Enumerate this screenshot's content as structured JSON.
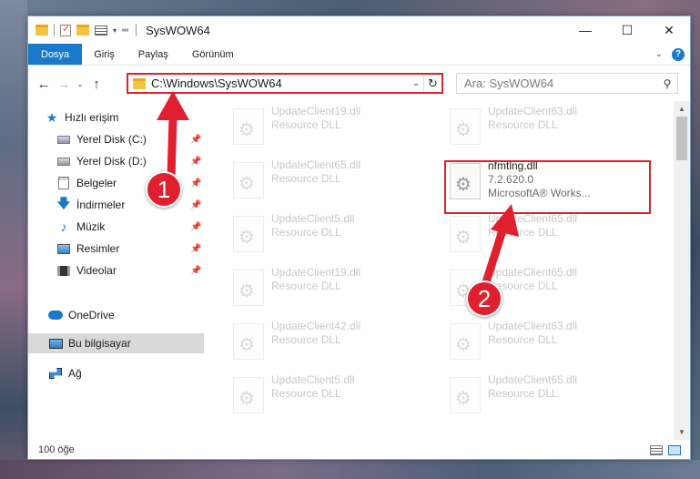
{
  "window": {
    "title": "SysWOW64",
    "minimize_glyph": "—",
    "maximize_glyph": "☐",
    "close_glyph": "✕"
  },
  "ribbon": {
    "tabs": [
      "Dosya",
      "Giriş",
      "Paylaş",
      "Görünüm"
    ],
    "expand_glyph": "⌄",
    "help_glyph": "?"
  },
  "navigation": {
    "back_glyph": "←",
    "forward_glyph": "→",
    "recent_glyph": "⌄",
    "up_glyph": "↑",
    "address_path": "C:\\Windows\\SysWOW64",
    "address_drop_glyph": "⌄",
    "refresh_glyph": "↻",
    "search_placeholder": "Ara: SysWOW64",
    "search_glyph": "⚲"
  },
  "sidebar": {
    "pin_glyph": "📌",
    "items": [
      {
        "label": "Hızlı erişim",
        "icon": "star-icon"
      },
      {
        "label": "Yerel Disk (C:)",
        "icon": "disk-icon",
        "pinned": true
      },
      {
        "label": "Yerel Disk (D:)",
        "icon": "disk-icon",
        "pinned": true
      },
      {
        "label": "Belgeler",
        "icon": "documents-icon",
        "pinned": true
      },
      {
        "label": "İndirmeler",
        "icon": "download-icon",
        "pinned": true
      },
      {
        "label": "Müzik",
        "icon": "music-icon",
        "pinned": true
      },
      {
        "label": "Resimler",
        "icon": "pictures-icon",
        "pinned": true
      },
      {
        "label": "Videolar",
        "icon": "videos-icon",
        "pinned": true
      },
      {
        "label": "OneDrive",
        "icon": "cloud-icon"
      },
      {
        "label": "Bu bilgisayar",
        "icon": "computer-icon",
        "selected": true
      },
      {
        "label": "Ağ",
        "icon": "network-icon"
      }
    ]
  },
  "files": {
    "left_column": [
      {
        "name": "UpdateClient19.dll",
        "type": "Resource DLL"
      },
      {
        "name": "UpdateClient65.dll",
        "type": "Resource DLL"
      },
      {
        "name": "UpdateClient5.dll",
        "type": "Resource DLL"
      },
      {
        "name": "UpdateClient19.dll",
        "type": "Resource DLL"
      },
      {
        "name": "UpdateClient42.dll",
        "type": "Resource DLL"
      },
      {
        "name": "UpdateClient5.dll",
        "type": "Resource DLL"
      }
    ],
    "right_column": [
      {
        "name": "UpdateClient63.dll",
        "type": "Resource DLL"
      },
      {
        "name": "UpdateClient65.dll",
        "type": "Resource DLL"
      },
      {
        "name": "UpdateClient65.dll",
        "type": "Resource DLL"
      },
      {
        "name": "UpdateClient63.dll",
        "type": "Resource DLL"
      },
      {
        "name": "UpdateClient65.dll",
        "type": "Resource DLL"
      }
    ],
    "highlighted": {
      "name": "nfmtlng.dll",
      "version": "7.2.620.0",
      "company": "MicrosoftA® Works..."
    }
  },
  "scrollbar": {
    "up_glyph": "▲",
    "down_glyph": "▼"
  },
  "status": {
    "item_count": "100 öğe"
  },
  "annotations": {
    "badge_1": "1",
    "badge_2": "2",
    "accent_color": "#e0202f"
  }
}
